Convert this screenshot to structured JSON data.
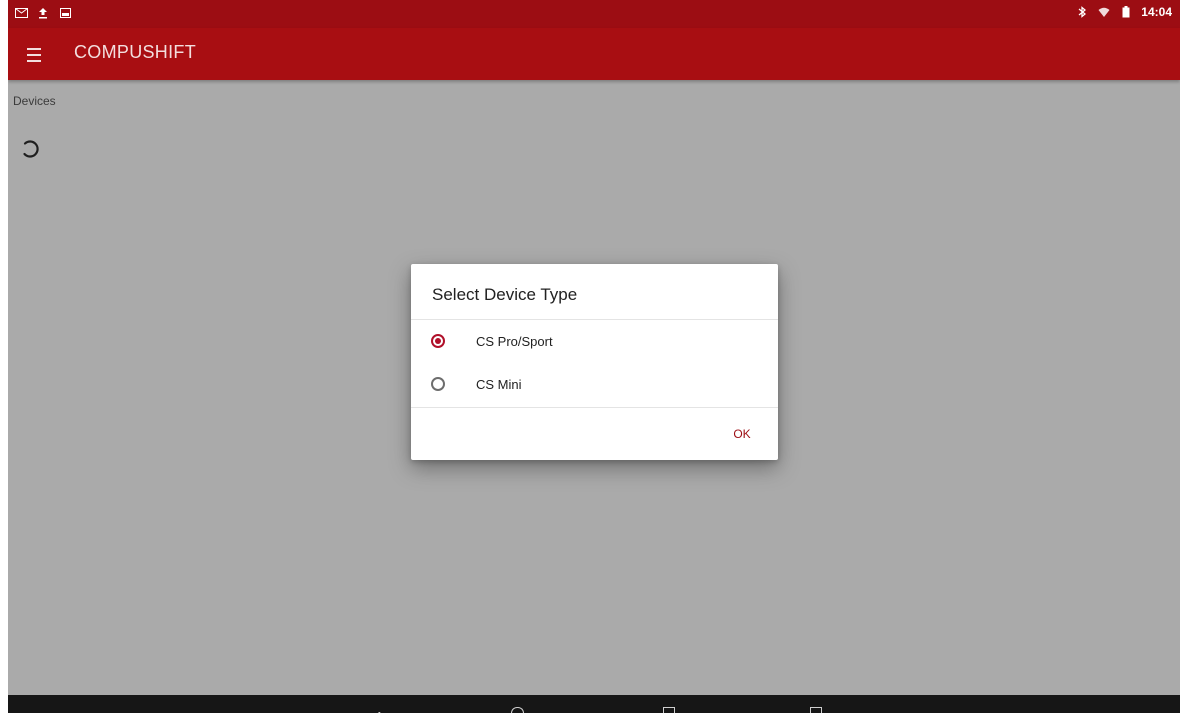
{
  "status_bar": {
    "time": "14:04",
    "left_icons": [
      "mail-icon",
      "upload-icon",
      "image-icon"
    ],
    "right_icons": [
      "bluetooth-icon",
      "wifi-icon",
      "battery-icon"
    ]
  },
  "toolbar": {
    "title": "COMPUSHIFT",
    "menu_icon": "hamburger-menu-icon"
  },
  "page": {
    "label": "Devices",
    "loading_icon": "spinner-icon"
  },
  "dialog": {
    "title": "Select Device Type",
    "options": [
      {
        "label": "CS Pro/Sport",
        "selected": true
      },
      {
        "label": "CS Mini",
        "selected": false
      }
    ],
    "ok_label": "OK"
  },
  "nav_bar": {
    "icons": [
      "back-icon",
      "home-icon",
      "recents-icon",
      "screenshot-icon"
    ]
  },
  "colors": {
    "status_bar": "#9c0d13",
    "toolbar": "#a80e12",
    "accent": "#b0102a",
    "scrim_background": "#aaaaaa",
    "nav_bar": "#161616"
  }
}
